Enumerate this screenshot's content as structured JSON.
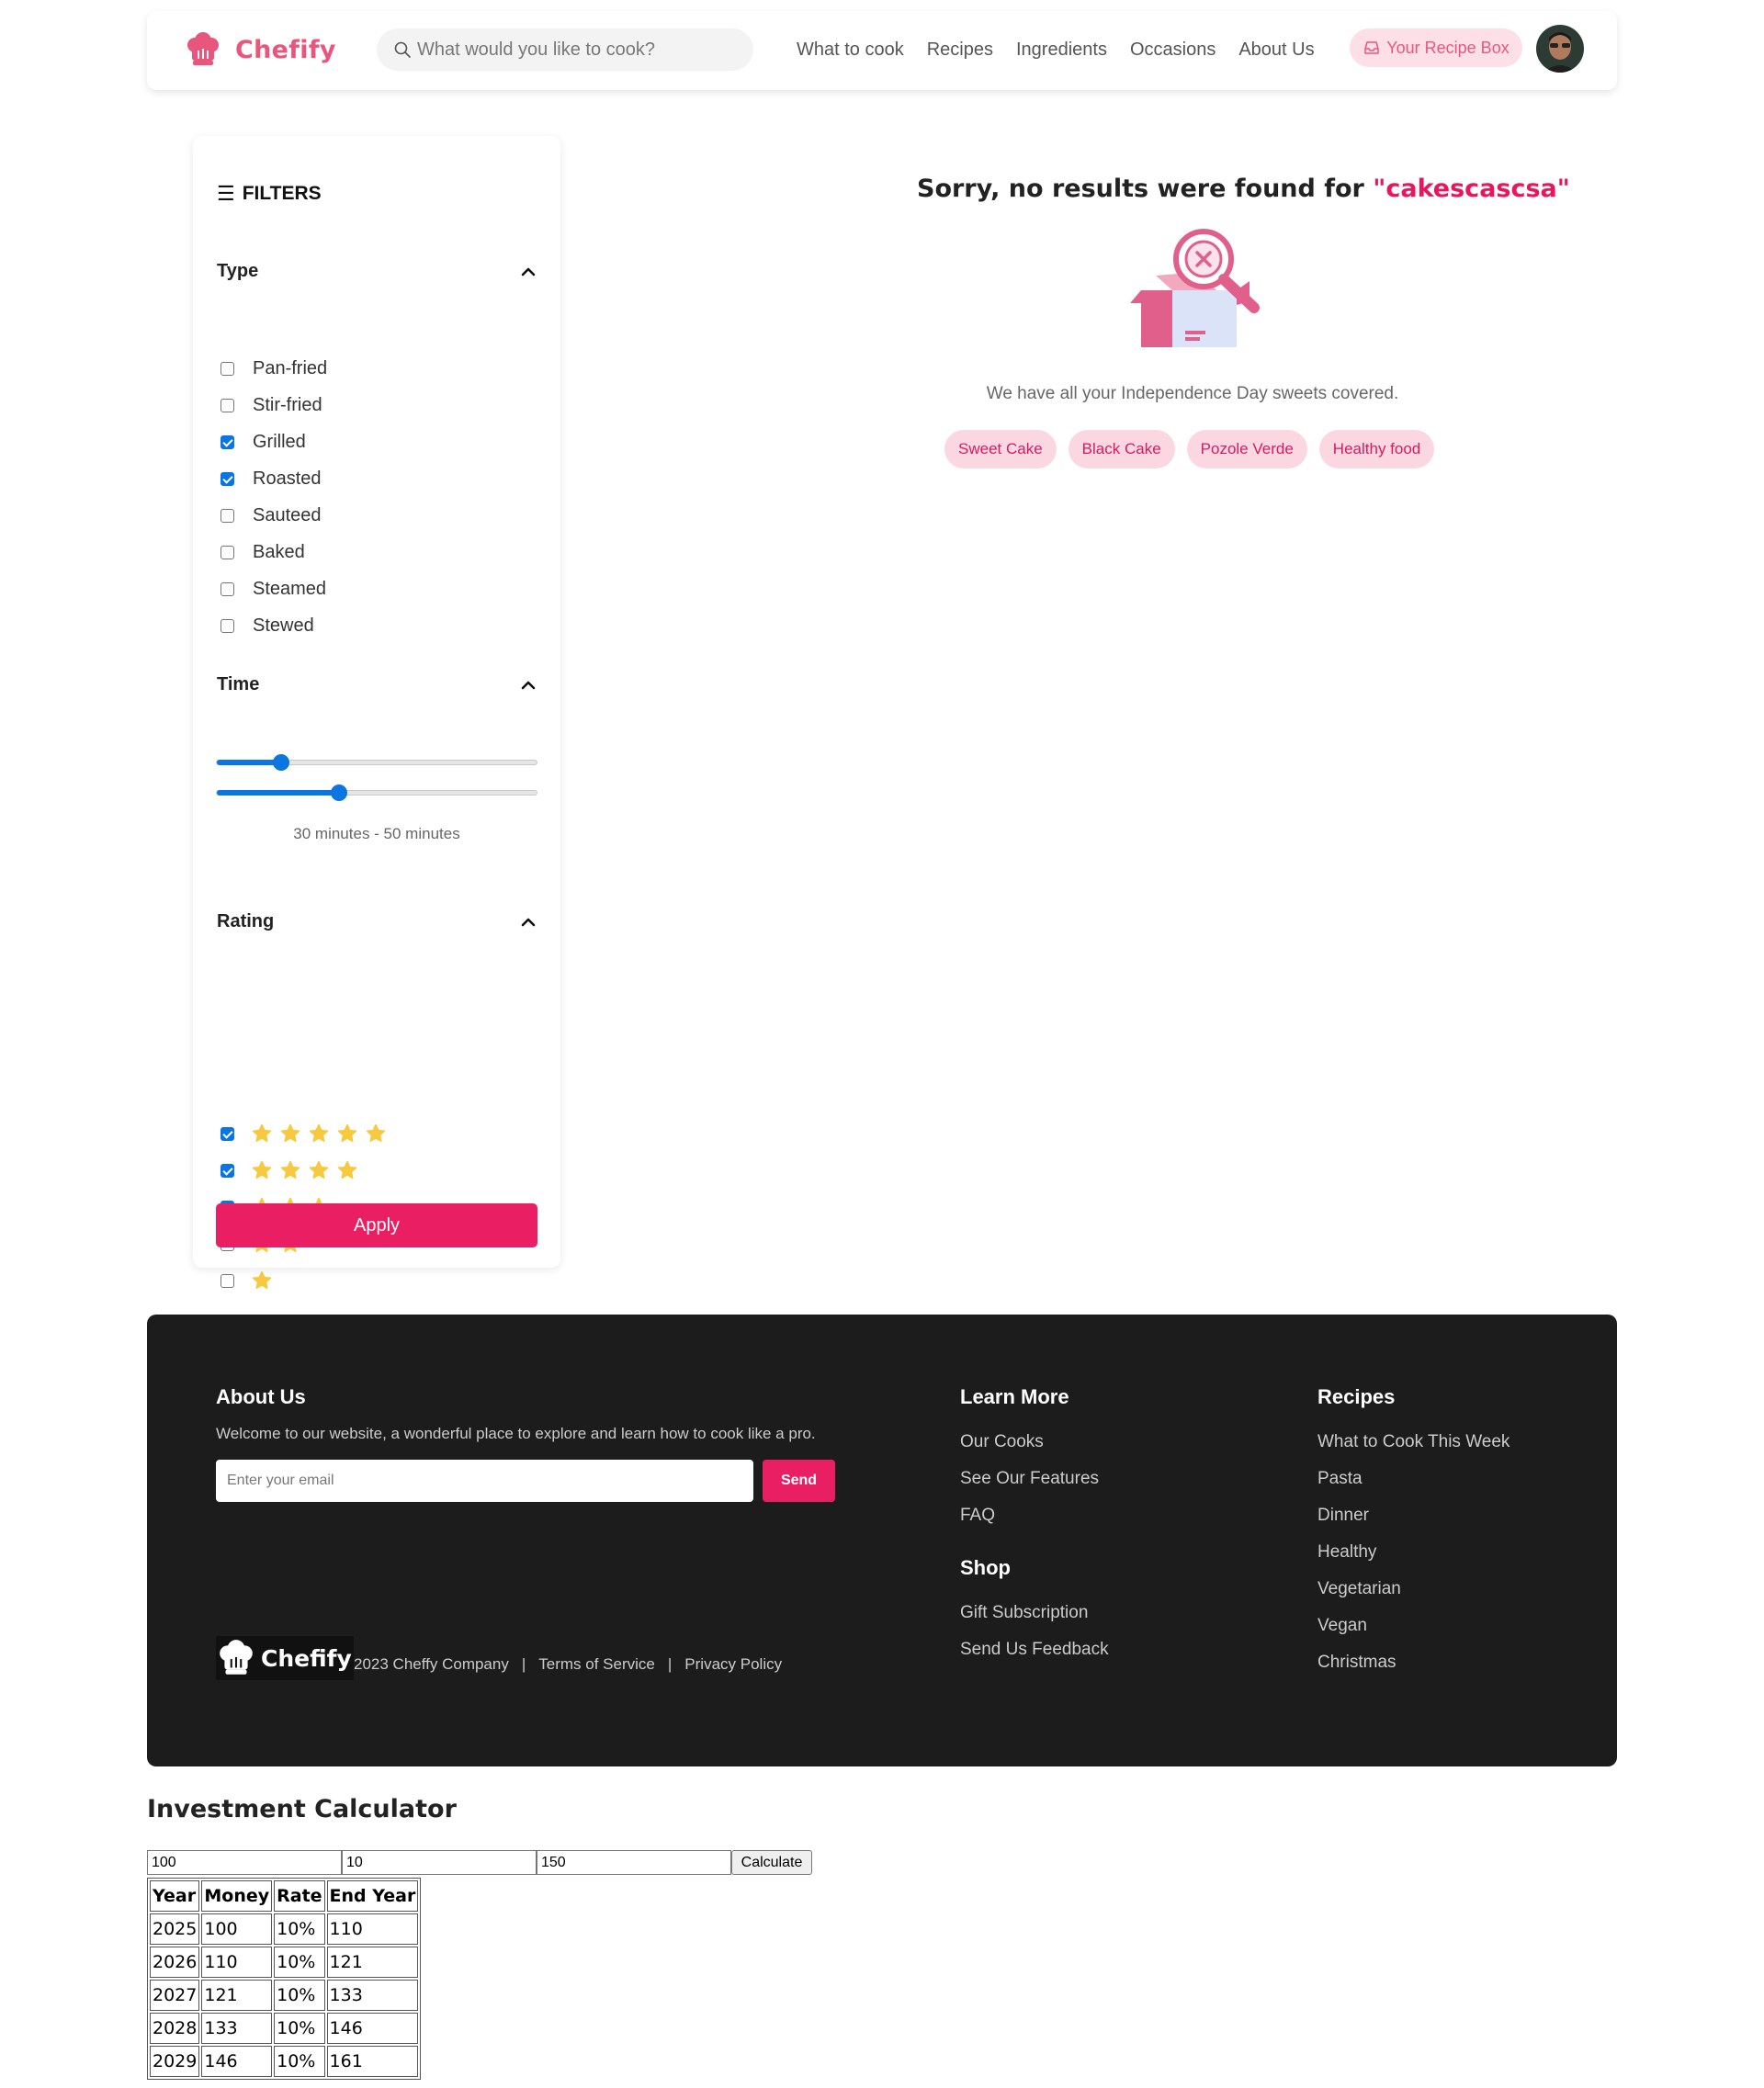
{
  "header": {
    "logo_text": "Chefify",
    "search_placeholder": "What would you like to cook?",
    "nav": [
      "What to cook",
      "Recipes",
      "Ingredients",
      "Occasions",
      "About Us"
    ],
    "recipe_box_label": "Your Recipe Box"
  },
  "filters": {
    "title": "FILTERS",
    "type": {
      "label": "Type",
      "options": [
        {
          "label": "Pan-fried",
          "checked": false
        },
        {
          "label": "Stir-fried",
          "checked": false
        },
        {
          "label": "Grilled",
          "checked": true
        },
        {
          "label": "Roasted",
          "checked": true
        },
        {
          "label": "Sauteed",
          "checked": false
        },
        {
          "label": "Baked",
          "checked": false
        },
        {
          "label": "Steamed",
          "checked": false
        },
        {
          "label": "Stewed",
          "checked": false
        }
      ]
    },
    "time": {
      "label": "Time",
      "min_fraction": 0.2,
      "max_fraction": 0.38,
      "range_text": "30 minutes - 50 minutes"
    },
    "rating": {
      "label": "Rating",
      "options": [
        {
          "stars": 5,
          "checked": true
        },
        {
          "stars": 4,
          "checked": true
        },
        {
          "stars": 3,
          "checked": true
        },
        {
          "stars": 2,
          "checked": false
        },
        {
          "stars": 1,
          "checked": false
        }
      ]
    },
    "apply_label": "Apply"
  },
  "results": {
    "no_result_prefix": "Sorry, no results were found for ",
    "query": "\"cakescascsa\"",
    "subtitle": "We have all your Independence Day sweets covered.",
    "suggestions": [
      "Sweet Cake",
      "Black Cake",
      "Pozole Verde",
      "Healthy food"
    ]
  },
  "footer": {
    "about_title": "About Us",
    "about_text": "Welcome to our website, a wonderful place to explore and learn how to cook like a pro.",
    "email_placeholder": "Enter your email",
    "send_label": "Send",
    "learn_more_title": "Learn More",
    "learn_more_links": [
      "Our Cooks",
      "See Our Features",
      "FAQ"
    ],
    "shop_title": "Shop",
    "shop_links": [
      "Gift Subscription",
      "Send Us Feedback"
    ],
    "recipes_title": "Recipes",
    "recipes_links": [
      "What to Cook This Week",
      "Pasta",
      "Dinner",
      "Healthy",
      "Vegetarian",
      "Vegan",
      "Christmas"
    ],
    "logo_text": "Chefify",
    "copyright": "2023 Cheffy Company",
    "separator": "|",
    "terms": "Terms of Service",
    "privacy": "Privacy Policy"
  },
  "calculator": {
    "title": "Investment Calculator",
    "inputs": [
      "100",
      "10",
      "150"
    ],
    "button_label": "Calculate",
    "headers": [
      "Year",
      "Money",
      "Rate",
      "End Year"
    ],
    "rows": [
      [
        "2025",
        "100",
        "10%",
        "110"
      ],
      [
        "2026",
        "110",
        "10%",
        "121"
      ],
      [
        "2027",
        "121",
        "10%",
        "133"
      ],
      [
        "2028",
        "133",
        "10%",
        "146"
      ],
      [
        "2029",
        "146",
        "10%",
        "161"
      ]
    ]
  },
  "colors": {
    "brand_pink": "#e8567e",
    "accent_pink": "#e91e63",
    "checkbox_blue": "#0b75e1",
    "star_yellow": "#f7c93e",
    "footer_bg": "#1c1c1c"
  }
}
